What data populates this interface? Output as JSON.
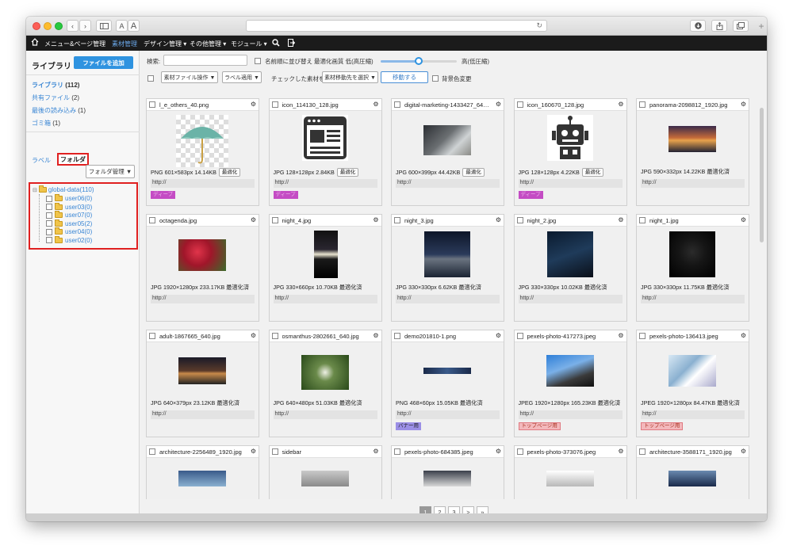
{
  "navbar": {
    "items": [
      "メニュー&ページ管理",
      "素材管理",
      "デザイン管理 ▾",
      "その他管理 ▾",
      "モジュール ▾"
    ]
  },
  "sidebar": {
    "title": "ライブラリ",
    "add_button": "ファイルを追加",
    "links": [
      {
        "label": "ライブラリ",
        "count": "(112)"
      },
      {
        "label": "共有ファイル",
        "count": "(2)"
      },
      {
        "label": "最後の読み込み",
        "count": "(1)"
      },
      {
        "label": "ゴミ箱",
        "count": "(1)"
      }
    ],
    "tab_label": "ラベル",
    "tab_folder": "フォルダ",
    "folder_manage": "フォルダ管理 ▼",
    "tree_root": "global-data(110)",
    "tree_children": [
      "user06(0)",
      "user03(0)",
      "user07(0)",
      "user05(2)",
      "user04(0)",
      "user02(0)"
    ]
  },
  "toolbar": {
    "search_label": "検索:",
    "sort_label": "名前順に並び替え",
    "optimize_label": "最適化画質 低(高圧縮)",
    "high_label": "高(低圧縮)",
    "slider_fraction": 0.5,
    "file_ops": "素材ファイル操作 ▼",
    "label_apply": "ラベル適用 ▼",
    "checked_label": "チェックした素材を",
    "move_select": "素材移動先を選択 ▼",
    "move_button": "移動する",
    "bg_label": "背景色変更"
  },
  "cards": [
    {
      "name": "l_e_others_40.png",
      "info": "PNG 601×583px  14.14KB",
      "opt": "最適化",
      "url": "http://",
      "tag": "ディープ"
    },
    {
      "name": "icon_114130_128.jpg",
      "info": "JPG 128×128px  2.84KB",
      "opt": "最適化",
      "url": "http://",
      "tag": "ディープ"
    },
    {
      "name": "digital-marketing-1433427_640.j...",
      "info": "JPG 600×399px  44.42KB",
      "opt": "最適化",
      "url": "http://",
      "tag": ""
    },
    {
      "name": "icon_160670_128.jpg",
      "info": "JPG 128×128px  4.22KB",
      "opt": "最適化",
      "url": "http://",
      "tag": "ディープ"
    },
    {
      "name": "panorama-2098812_1920.jpg",
      "info": "JPG 590×332px  14.22KB 最適化済",
      "opt": "",
      "url": "http://",
      "tag": ""
    },
    {
      "name": "octagenda.jpg",
      "info": "JPG 1920×1280px  233.17KB 最適化済",
      "opt": "",
      "url": "http://",
      "tag": ""
    },
    {
      "name": "night_4.jpg",
      "info": "JPG 330×660px  10.70KB 最適化済",
      "opt": "",
      "url": "http://",
      "tag": ""
    },
    {
      "name": "night_3.jpg",
      "info": "JPG 330×330px  6.62KB 最適化済",
      "opt": "",
      "url": "http://",
      "tag": ""
    },
    {
      "name": "night_2.jpg",
      "info": "JPG 330×330px  10.02KB 最適化済",
      "opt": "",
      "url": "http://",
      "tag": ""
    },
    {
      "name": "night_1.jpg",
      "info": "JPG 330×330px  11.75KB 最適化済",
      "opt": "",
      "url": "http://",
      "tag": ""
    },
    {
      "name": "adult-1867665_640.jpg",
      "info": "JPG 640×379px  23.12KB 最適化済",
      "opt": "",
      "url": "http://",
      "tag": ""
    },
    {
      "name": "osmanthus-2802661_640.jpg",
      "info": "JPG 640×480px  51.03KB 最適化済",
      "opt": "",
      "url": "http://",
      "tag": ""
    },
    {
      "name": "demo201810-1.png",
      "info": "PNG 468×60px  15.05KB 最適化済",
      "opt": "",
      "url": "http://",
      "tag": "バナー用"
    },
    {
      "name": "pexels-photo-417273.jpeg",
      "info": "JPEG 1920×1280px  165.23KB 最適化済",
      "opt": "",
      "url": "http://",
      "tag": "トップページ用"
    },
    {
      "name": "pexels-photo-136413.jpeg",
      "info": "JPEG 1920×1280px  84.47KB 最適化済",
      "opt": "",
      "url": "http://",
      "tag": "トップページ用"
    },
    {
      "name": "architecture-2256489_1920.jpg",
      "info": "",
      "opt": "",
      "url": "",
      "tag": ""
    },
    {
      "name": "sidebar",
      "info": "",
      "opt": "",
      "url": "",
      "tag": ""
    },
    {
      "name": "pexels-photo-684385.jpeg",
      "info": "",
      "opt": "",
      "url": "",
      "tag": ""
    },
    {
      "name": "pexels-photo-373076.jpeg",
      "info": "",
      "opt": "",
      "url": "",
      "tag": ""
    },
    {
      "name": "architecture-3588171_1920.jpg",
      "info": "",
      "opt": "",
      "url": "",
      "tag": ""
    }
  ],
  "pager": [
    "1",
    "2",
    "3",
    ">",
    "»"
  ]
}
